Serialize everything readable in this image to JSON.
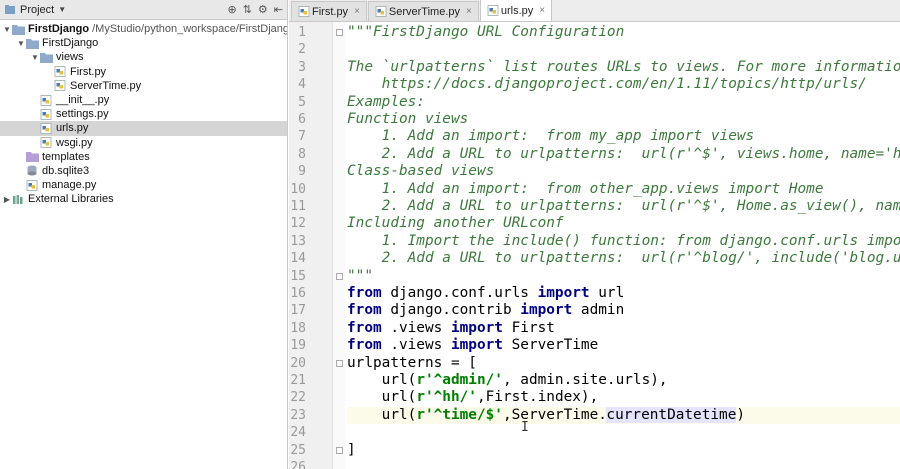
{
  "project": {
    "title": "Project",
    "tree": [
      {
        "label": "FirstDjango",
        "path": "/MyStudio/python_workspace/FirstDjango",
        "depth": 0,
        "type": "folder",
        "open": true,
        "bold": true
      },
      {
        "label": "FirstDjango",
        "depth": 1,
        "type": "folder",
        "open": true
      },
      {
        "label": "views",
        "depth": 2,
        "type": "folder",
        "open": true
      },
      {
        "label": "First.py",
        "depth": 3,
        "type": "py"
      },
      {
        "label": "ServerTime.py",
        "depth": 3,
        "type": "py"
      },
      {
        "label": "__init__.py",
        "depth": 2,
        "type": "py"
      },
      {
        "label": "settings.py",
        "depth": 2,
        "type": "py"
      },
      {
        "label": "urls.py",
        "depth": 2,
        "type": "py",
        "selected": true
      },
      {
        "label": "wsgi.py",
        "depth": 2,
        "type": "py"
      },
      {
        "label": "templates",
        "depth": 1,
        "type": "folder-purple"
      },
      {
        "label": "db.sqlite3",
        "depth": 1,
        "type": "db"
      },
      {
        "label": "manage.py",
        "depth": 1,
        "type": "py"
      },
      {
        "label": "External Libraries",
        "depth": 0,
        "type": "lib",
        "open": false
      }
    ]
  },
  "tabs": [
    {
      "label": "First.py",
      "active": false
    },
    {
      "label": "ServerTime.py",
      "active": false
    },
    {
      "label": "urls.py",
      "active": true
    }
  ],
  "code": {
    "current_line": 23,
    "lines": [
      [
        {
          "t": "doc",
          "v": "\"\"\"FirstDjango URL Configuration"
        }
      ],
      [],
      [
        {
          "t": "doc",
          "v": "The `urlpatterns` list routes URLs to views. For more informatio"
        }
      ],
      [
        {
          "t": "doc",
          "v": "    https://docs.djangoproject.com/en/1.11/topics/http/urls/"
        }
      ],
      [
        {
          "t": "doc",
          "v": "Examples:"
        }
      ],
      [
        {
          "t": "doc",
          "v": "Function views"
        }
      ],
      [
        {
          "t": "doc",
          "v": "    1. Add an import:  from my_app import views"
        }
      ],
      [
        {
          "t": "doc",
          "v": "    2. Add a URL to urlpatterns:  url(r'^$', views.home, name='h"
        }
      ],
      [
        {
          "t": "doc",
          "v": "Class-based views"
        }
      ],
      [
        {
          "t": "doc",
          "v": "    1. Add an import:  from other_app.views import Home"
        }
      ],
      [
        {
          "t": "doc",
          "v": "    2. Add a URL to urlpatterns:  url(r'^$', Home.as_view(), nam"
        }
      ],
      [
        {
          "t": "doc",
          "v": "Including another URLconf"
        }
      ],
      [
        {
          "t": "doc",
          "v": "    1. Import the include() function: from django.conf.urls impo"
        }
      ],
      [
        {
          "t": "doc",
          "v": "    2. Add a URL to urlpatterns:  url(r'^blog/', include('blog.u"
        }
      ],
      [
        {
          "t": "doc",
          "v": "\"\"\""
        }
      ],
      [
        {
          "t": "kw",
          "v": "from"
        },
        {
          "t": "plain",
          "v": " django.conf.urls "
        },
        {
          "t": "kw",
          "v": "import"
        },
        {
          "t": "plain",
          "v": " url"
        }
      ],
      [
        {
          "t": "kw",
          "v": "from"
        },
        {
          "t": "plain",
          "v": " django.contrib "
        },
        {
          "t": "kw",
          "v": "import"
        },
        {
          "t": "plain",
          "v": " admin"
        }
      ],
      [
        {
          "t": "kw",
          "v": "from"
        },
        {
          "t": "plain",
          "v": " .views "
        },
        {
          "t": "kw",
          "v": "import"
        },
        {
          "t": "plain",
          "v": " First"
        }
      ],
      [
        {
          "t": "kw",
          "v": "from"
        },
        {
          "t": "plain",
          "v": " .views "
        },
        {
          "t": "kw",
          "v": "import"
        },
        {
          "t": "plain",
          "v": " ServerTime"
        }
      ],
      [
        {
          "t": "plain",
          "v": "urlpatterns = ["
        }
      ],
      [
        {
          "t": "plain",
          "v": "    url("
        },
        {
          "t": "str",
          "v": "r'^admin/'"
        },
        {
          "t": "plain",
          "v": ", admin.site.urls),"
        }
      ],
      [
        {
          "t": "plain",
          "v": "    url("
        },
        {
          "t": "str",
          "v": "r'^hh/'"
        },
        {
          "t": "plain",
          "v": ",First.index),"
        }
      ],
      [
        {
          "t": "plain",
          "v": "    url("
        },
        {
          "t": "str",
          "v": "r'^time/$'"
        },
        {
          "t": "plain",
          "v": ",ServerTime."
        },
        {
          "t": "caret",
          "v": ""
        },
        {
          "t": "hl",
          "v": "currentDatetime"
        },
        {
          "t": "plain",
          "v": ")"
        }
      ],
      [],
      [
        {
          "t": "plain",
          "v": "]"
        }
      ],
      []
    ]
  },
  "colors": {
    "docstring": "#3d7a3d",
    "keyword": "#000080",
    "string": "#008000",
    "selection": "#d5d5d5",
    "current_line": "#fcfae8"
  }
}
